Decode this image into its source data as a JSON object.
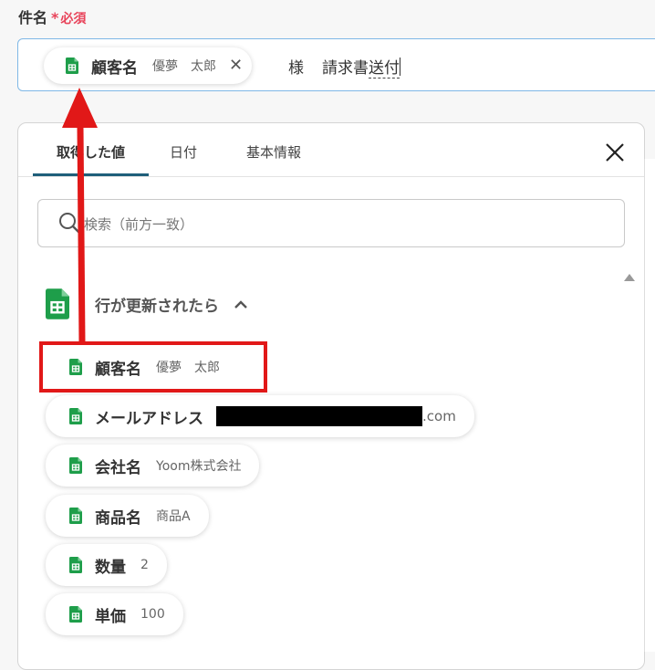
{
  "field": {
    "label": "件名",
    "required_mark": "*",
    "required_text": "必須"
  },
  "subject": {
    "chip_label": "顧客名",
    "chip_value": "優夢　太郎",
    "suffix_sama": "様",
    "suffix_text": "請求書",
    "suffix_cursor_text": "送付"
  },
  "tabs": [
    {
      "label": "取得した値",
      "active": true
    },
    {
      "label": "日付",
      "active": false
    },
    {
      "label": "基本情報",
      "active": false
    }
  ],
  "search": {
    "placeholder": "検索（前方一致）"
  },
  "group": {
    "title": "行が更新されたら"
  },
  "items": [
    {
      "label": "顧客名",
      "value": "優夢　太郎"
    },
    {
      "label": "メールアドレス",
      "value": ".com"
    },
    {
      "label": "会社名",
      "value": "Yoom株式会社"
    },
    {
      "label": "商品名",
      "value": "商品A"
    },
    {
      "label": "数量",
      "value": "2"
    },
    {
      "label": "単価",
      "value": "100"
    }
  ],
  "colors": {
    "accent_tab": "#1f5f7a",
    "required": "#e8435a",
    "highlight": "#e11818",
    "sheets_green": "#1e9e4a"
  }
}
